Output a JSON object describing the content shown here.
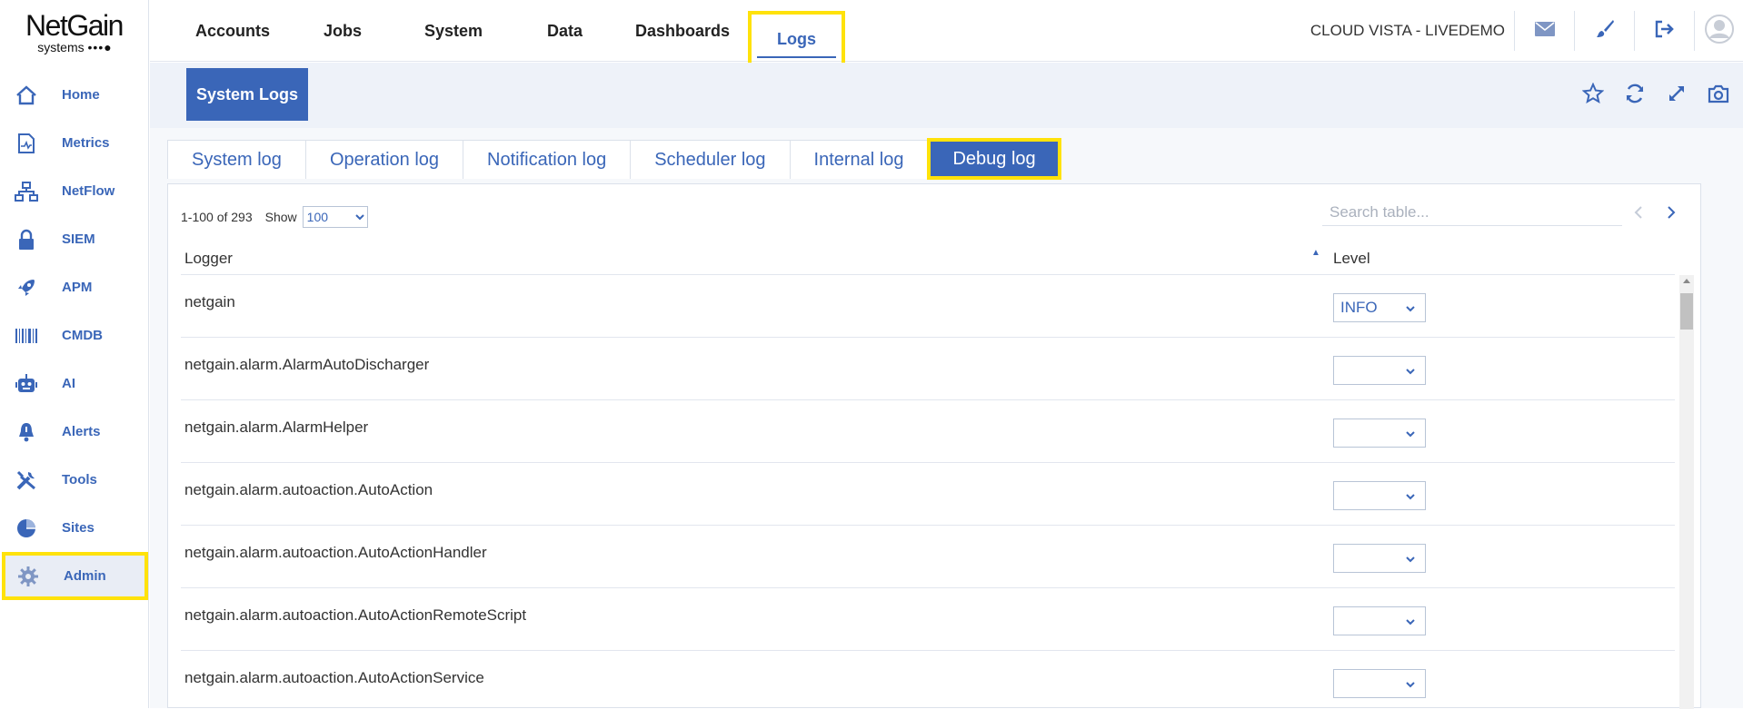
{
  "brand": {
    "name": "NetGain",
    "sub": "systems",
    "dots": "•••●"
  },
  "sidebar": {
    "items": [
      {
        "label": "Home",
        "icon": "home-icon"
      },
      {
        "label": "Metrics",
        "icon": "metrics-icon"
      },
      {
        "label": "NetFlow",
        "icon": "netflow-icon"
      },
      {
        "label": "SIEM",
        "icon": "lock-icon"
      },
      {
        "label": "APM",
        "icon": "rocket-icon"
      },
      {
        "label": "CMDB",
        "icon": "barcode-icon"
      },
      {
        "label": "AI",
        "icon": "robot-icon"
      },
      {
        "label": "Alerts",
        "icon": "bell-icon"
      },
      {
        "label": "Tools",
        "icon": "tools-icon"
      },
      {
        "label": "Sites",
        "icon": "pie-icon"
      },
      {
        "label": "Admin",
        "icon": "gear-icon",
        "active": true
      }
    ]
  },
  "topnav": {
    "tabs": [
      "Accounts",
      "Jobs",
      "System",
      "Data",
      "Dashboards",
      "Logs"
    ],
    "active": "Logs"
  },
  "account": {
    "org": "CLOUD VISTA - LIVEDEMO"
  },
  "page": {
    "title": "System Logs"
  },
  "logtabs": {
    "tabs": [
      "System log",
      "Operation log",
      "Notification log",
      "Scheduler log",
      "Internal log",
      "Debug log"
    ],
    "active": "Debug log"
  },
  "table": {
    "range": "1-100 of 293",
    "show_label": "Show",
    "page_size": "100",
    "search_placeholder": "Search table...",
    "columns": {
      "logger": "Logger",
      "level": "Level"
    },
    "rows": [
      {
        "logger": "netgain",
        "level": "INFO"
      },
      {
        "logger": "netgain.alarm.AlarmAutoDischarger",
        "level": ""
      },
      {
        "logger": "netgain.alarm.AlarmHelper",
        "level": ""
      },
      {
        "logger": "netgain.alarm.autoaction.AutoAction",
        "level": ""
      },
      {
        "logger": "netgain.alarm.autoaction.AutoActionHandler",
        "level": ""
      },
      {
        "logger": "netgain.alarm.autoaction.AutoActionRemoteScript",
        "level": ""
      },
      {
        "logger": "netgain.alarm.autoaction.AutoActionService",
        "level": ""
      }
    ]
  },
  "colors": {
    "accent": "#3a66b8",
    "highlight": "#ffe20a",
    "subbar": "#eef2f9"
  }
}
